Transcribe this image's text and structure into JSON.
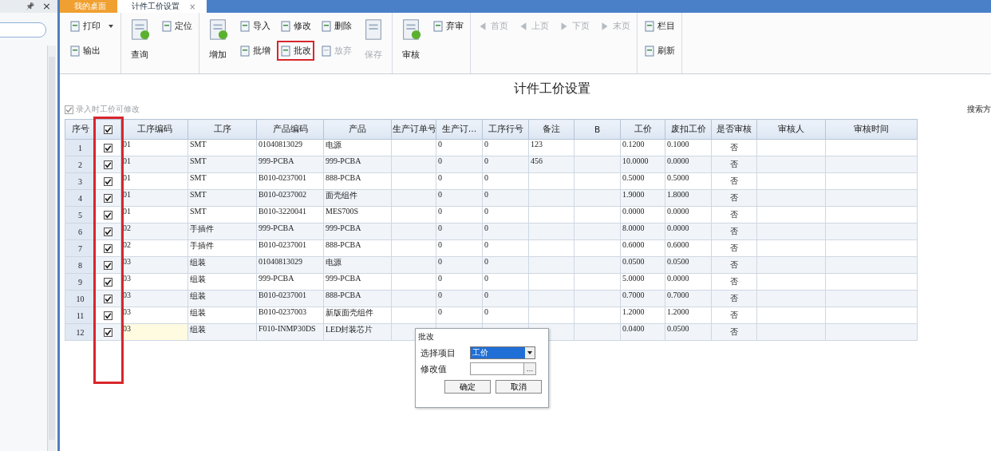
{
  "side_pane": {
    "pin": "📌",
    "close": "×"
  },
  "tabs": [
    {
      "label": "我的桌面",
      "selected": false,
      "closable": false
    },
    {
      "label": "计件工价设置",
      "selected": true,
      "closable": true
    }
  ],
  "tab_close": "×",
  "toolbar": [
    {
      "columns": [
        {
          "kind": "small",
          "buttons": [
            {
              "label": "打印",
              "dropdown": true,
              "disabled": false,
              "highlighted": false
            },
            {
              "label": "输出",
              "dropdown": false,
              "disabled": false,
              "highlighted": false
            }
          ]
        }
      ]
    },
    {
      "columns": [
        {
          "kind": "large",
          "buttons": [
            {
              "label": "查询",
              "dropdown": false,
              "disabled": false,
              "highlighted": false
            }
          ]
        },
        {
          "kind": "small",
          "buttons": [
            {
              "label": "定位",
              "dropdown": false,
              "disabled": false,
              "highlighted": false
            }
          ]
        }
      ]
    },
    {
      "columns": [
        {
          "kind": "large",
          "buttons": [
            {
              "label": "增加",
              "dropdown": false,
              "disabled": false,
              "highlighted": false
            }
          ]
        },
        {
          "kind": "small",
          "buttons": [
            {
              "label": "导入",
              "dropdown": false,
              "disabled": false,
              "highlighted": false
            },
            {
              "label": "批增",
              "dropdown": false,
              "disabled": false,
              "highlighted": false
            }
          ]
        },
        {
          "kind": "small",
          "buttons": [
            {
              "label": "修改",
              "dropdown": false,
              "disabled": false,
              "highlighted": false
            },
            {
              "label": "批改",
              "dropdown": false,
              "disabled": false,
              "highlighted": true
            }
          ]
        },
        {
          "kind": "small",
          "buttons": [
            {
              "label": "删除",
              "dropdown": false,
              "disabled": false,
              "highlighted": false
            },
            {
              "label": "放弃",
              "dropdown": false,
              "disabled": true,
              "highlighted": false
            }
          ]
        },
        {
          "kind": "large",
          "buttons": [
            {
              "label": "保存",
              "dropdown": false,
              "disabled": true,
              "highlighted": false
            }
          ]
        }
      ]
    },
    {
      "columns": [
        {
          "kind": "large",
          "buttons": [
            {
              "label": "审核",
              "dropdown": false,
              "disabled": false,
              "highlighted": false
            }
          ]
        },
        {
          "kind": "small",
          "buttons": [
            {
              "label": "弃审",
              "dropdown": false,
              "disabled": false,
              "highlighted": false
            }
          ]
        }
      ]
    },
    {
      "columns": [
        {
          "kind": "nav",
          "buttons": [
            {
              "label": "首页",
              "dropdown": false,
              "disabled": true,
              "highlighted": false
            }
          ]
        },
        {
          "kind": "nav",
          "buttons": [
            {
              "label": "上页",
              "dropdown": false,
              "disabled": true,
              "highlighted": false
            }
          ]
        },
        {
          "kind": "nav",
          "buttons": [
            {
              "label": "下页",
              "dropdown": false,
              "disabled": true,
              "highlighted": false
            }
          ]
        },
        {
          "kind": "nav",
          "buttons": [
            {
              "label": "末页",
              "dropdown": false,
              "disabled": true,
              "highlighted": false
            }
          ]
        }
      ]
    },
    {
      "columns": [
        {
          "kind": "small",
          "buttons": [
            {
              "label": "栏目",
              "dropdown": false,
              "disabled": false,
              "highlighted": false
            },
            {
              "label": "刷新",
              "dropdown": false,
              "disabled": false,
              "highlighted": false
            }
          ]
        }
      ]
    }
  ],
  "page_title": "计件工价设置",
  "editable_option": {
    "label": "录入时工价可修改",
    "checked": true,
    "disabled": true
  },
  "search_label": "搜索方",
  "table": {
    "columns": [
      {
        "kind": "text",
        "label": "序号"
      },
      {
        "kind": "checkbox",
        "checked": true
      },
      {
        "kind": "text",
        "label": "工序编码"
      },
      {
        "kind": "text",
        "label": "工序"
      },
      {
        "kind": "text",
        "label": "产品编码"
      },
      {
        "kind": "text",
        "label": "产品"
      },
      {
        "kind": "text",
        "label": "生产订单号"
      },
      {
        "kind": "text",
        "label": "生产订…"
      },
      {
        "kind": "text",
        "label": "工序行号"
      },
      {
        "kind": "text",
        "label": "备注"
      },
      {
        "kind": "text",
        "label": "B"
      },
      {
        "kind": "text",
        "label": "工价"
      },
      {
        "kind": "text",
        "label": "废扣工价"
      },
      {
        "kind": "text",
        "label": "是否审核"
      },
      {
        "kind": "text",
        "label": "审核人"
      },
      {
        "kind": "text",
        "label": "审核时间"
      }
    ],
    "checkbox_column_highlighted": true,
    "rows": [
      {
        "active": false,
        "cells": [
          "1",
          {
            "checked": true
          },
          "01",
          "SMT",
          "01040813029",
          "电源",
          "",
          "0",
          "0",
          "123",
          "",
          "0.1200",
          "0.1000",
          "否",
          "",
          ""
        ]
      },
      {
        "active": false,
        "cells": [
          "2",
          {
            "checked": true
          },
          "01",
          "SMT",
          "999-PCBA",
          "999-PCBA",
          "",
          "0",
          "0",
          "456",
          "",
          "10.0000",
          "0.0000",
          "否",
          "",
          ""
        ]
      },
      {
        "active": false,
        "cells": [
          "3",
          {
            "checked": true
          },
          "01",
          "SMT",
          "B010-0237001",
          "888-PCBA",
          "",
          "0",
          "0",
          "",
          "",
          "0.5000",
          "0.5000",
          "否",
          "",
          ""
        ]
      },
      {
        "active": false,
        "cells": [
          "4",
          {
            "checked": true
          },
          "01",
          "SMT",
          "B010-0237002",
          "面壳组件",
          "",
          "0",
          "0",
          "",
          "",
          "1.9000",
          "1.8000",
          "否",
          "",
          ""
        ]
      },
      {
        "active": false,
        "cells": [
          "5",
          {
            "checked": true
          },
          "01",
          "SMT",
          "B010-3220041",
          "MES700S",
          "",
          "0",
          "0",
          "",
          "",
          "0.0000",
          "0.0000",
          "否",
          "",
          ""
        ]
      },
      {
        "active": false,
        "cells": [
          "6",
          {
            "checked": true
          },
          "02",
          "手插件",
          "999-PCBA",
          "999-PCBA",
          "",
          "0",
          "0",
          "",
          "",
          "8.0000",
          "0.0000",
          "否",
          "",
          ""
        ]
      },
      {
        "active": false,
        "cells": [
          "7",
          {
            "checked": true
          },
          "02",
          "手插件",
          "B010-0237001",
          "888-PCBA",
          "",
          "0",
          "0",
          "",
          "",
          "0.6000",
          "0.6000",
          "否",
          "",
          ""
        ]
      },
      {
        "active": false,
        "cells": [
          "8",
          {
            "checked": true
          },
          "03",
          "组装",
          "01040813029",
          "电源",
          "",
          "0",
          "0",
          "",
          "",
          "0.0500",
          "0.0500",
          "否",
          "",
          ""
        ]
      },
      {
        "active": false,
        "cells": [
          "9",
          {
            "checked": true
          },
          "03",
          "组装",
          "999-PCBA",
          "999-PCBA",
          "",
          "0",
          "0",
          "",
          "",
          "5.0000",
          "0.0000",
          "否",
          "",
          ""
        ]
      },
      {
        "active": false,
        "cells": [
          "10",
          {
            "checked": true
          },
          "03",
          "组装",
          "B010-0237001",
          "888-PCBA",
          "",
          "0",
          "0",
          "",
          "",
          "0.7000",
          "0.7000",
          "否",
          "",
          ""
        ]
      },
      {
        "active": false,
        "cells": [
          "11",
          {
            "checked": true
          },
          "03",
          "组装",
          "B010-0237003",
          "新版面壳组件",
          "",
          "0",
          "0",
          "",
          "",
          "1.2000",
          "1.2000",
          "否",
          "",
          ""
        ]
      },
      {
        "active": true,
        "cells": [
          "12",
          {
            "checked": true
          },
          "03",
          "组装",
          "F010-INMP30DS",
          "LED封装芯片",
          "",
          "",
          "",
          "",
          "",
          "0.0400",
          "0.0500",
          "否",
          "",
          ""
        ]
      }
    ]
  },
  "dialog": {
    "title": "批改",
    "select_label": "选择项目",
    "select_value": "工价",
    "value_label": "修改值",
    "browse": "…",
    "ok": "确定",
    "cancel": "取消"
  }
}
